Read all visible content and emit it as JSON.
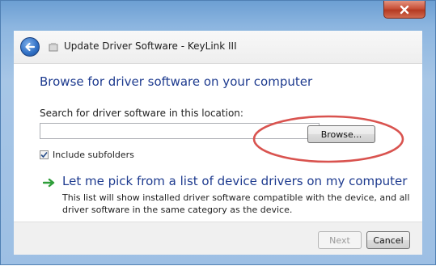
{
  "window": {
    "title": "Update Driver Software - KeyLink III",
    "close_icon": "close-icon",
    "back_icon": "back-arrow-icon"
  },
  "main": {
    "heading": "Browse for driver software on your computer",
    "search_label": "Search for driver software in this location:",
    "path_value": "",
    "browse_label": "Browse...",
    "include_subfolders": {
      "label": "Include subfolders",
      "checked": true
    },
    "pick_option": {
      "title": "Let me pick from a list of device drivers on my computer",
      "description": "This list will show installed driver software compatible with the device, and all driver software in the same category as the device."
    }
  },
  "footer": {
    "next_label": "Next",
    "cancel_label": "Cancel"
  },
  "colors": {
    "heading": "#1e3b8f",
    "accent_arrow": "#2f9e3a",
    "annotation": "#d9534f"
  }
}
